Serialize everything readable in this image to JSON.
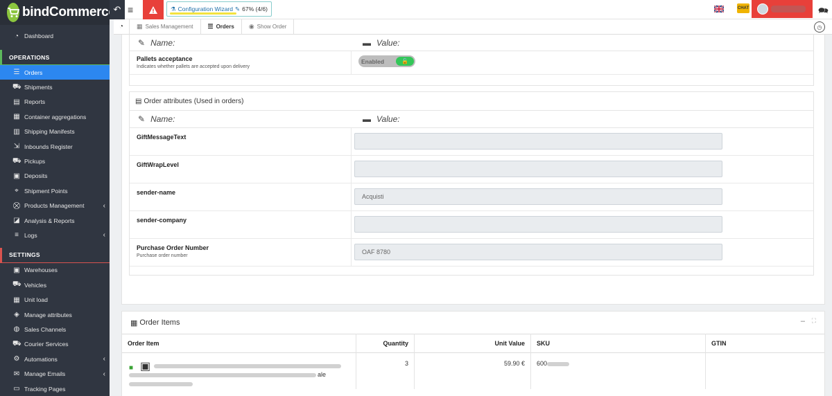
{
  "brand": {
    "name_prefix": "bind",
    "name_suffix": "Commerce"
  },
  "sidebar": {
    "dashboard": "Dashboard",
    "section_operations": "OPERATIONS",
    "operations": [
      {
        "label": "Orders",
        "icon": "orders-icon",
        "active": true
      },
      {
        "label": "Shipments",
        "icon": "truck-icon"
      },
      {
        "label": "Reports",
        "icon": "report-icon"
      },
      {
        "label": "Container aggregations",
        "icon": "pallet-icon"
      },
      {
        "label": "Shipping Manifests",
        "icon": "manifest-icon"
      },
      {
        "label": "Inbounds Register",
        "icon": "inbound-icon"
      },
      {
        "label": "Pickups",
        "icon": "pickup-icon"
      },
      {
        "label": "Deposits",
        "icon": "deposit-icon"
      },
      {
        "label": "Shipment Points",
        "icon": "map-pin-icon"
      },
      {
        "label": "Products Management",
        "icon": "cart-icon",
        "expandable": true
      },
      {
        "label": "Analysis & Reports",
        "icon": "chart-icon"
      },
      {
        "label": "Logs",
        "icon": "list-icon",
        "expandable": true
      }
    ],
    "section_settings": "SETTINGS",
    "settings": [
      {
        "label": "Warehouses",
        "icon": "warehouse-icon"
      },
      {
        "label": "Vehicles",
        "icon": "vehicle-icon"
      },
      {
        "label": "Unit load",
        "icon": "unit-load-icon"
      },
      {
        "label": "Manage attributes",
        "icon": "attributes-icon"
      },
      {
        "label": "Sales Channels",
        "icon": "sales-channel-icon"
      },
      {
        "label": "Courier Services",
        "icon": "courier-icon"
      },
      {
        "label": "Automations",
        "icon": "cogs-icon",
        "expandable": true
      },
      {
        "label": "Manage Emails",
        "icon": "envelope-icon",
        "expandable": true
      },
      {
        "label": "Tracking Pages",
        "icon": "tracking-icon"
      }
    ]
  },
  "topbar": {
    "wizard_label": "Configuration Wizard",
    "wizard_progress": "67% (4/6)",
    "chat_badge": "CHAT"
  },
  "breadcrumb": {
    "items": [
      "Sales Management",
      "Orders",
      "Show Order"
    ]
  },
  "attributes_panel": {
    "name_header": "Name:",
    "value_header": "Value:",
    "pallets": {
      "name": "Pallets acceptance",
      "description": "Indicates whether pallets are accepted upon delivery",
      "toggle_label": "Enabled"
    }
  },
  "order_attributes": {
    "title": "Order attributes (Used in orders)",
    "name_header": "Name:",
    "value_header": "Value:",
    "rows": [
      {
        "name": "GiftMessageText",
        "description": "",
        "value": ""
      },
      {
        "name": "GiftWrapLevel",
        "description": "",
        "value": ""
      },
      {
        "name": "sender-name",
        "description": "",
        "value": "Acquisti"
      },
      {
        "name": "sender-company",
        "description": "",
        "value": ""
      },
      {
        "name": "Purchase Order Number",
        "description": "Purchase order number",
        "value": "OAF 8780"
      }
    ]
  },
  "order_items": {
    "title": "Order Items",
    "columns": [
      "Order Item",
      "Quantity",
      "Unit Value",
      "SKU",
      "GTIN"
    ],
    "rows": [
      {
        "item_text": "ale",
        "quantity": "3",
        "unit_value": "59.90 €",
        "sku": "600",
        "gtin": ""
      }
    ]
  }
}
